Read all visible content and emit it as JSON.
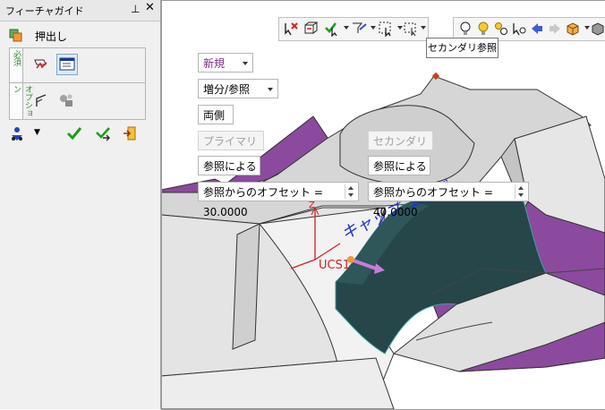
{
  "panel": {
    "title": "フィーチャガイド",
    "pin_icon": "pin-icon",
    "close_icon": "close-icon",
    "command_name": "押出し",
    "required_tab": "必須",
    "optional_tab": "オプション"
  },
  "viewport": {
    "tooltip": "セカンダリ参照",
    "mode_dropdown": "新規",
    "boolean_dropdown": "増分/参照",
    "direction_button": "両側",
    "primary_label": "プライマリ側",
    "secondary_label": "セカンダリ側",
    "primary_ref": "参照による",
    "secondary_ref": "参照による",
    "primary_offset": "参照からのオフセット = 30.0000",
    "secondary_offset": "参照からのオフセット = 40.0000",
    "annotation": "キャップ エンド",
    "csys_label": "UCS1",
    "axis_label": "Z"
  },
  "colors": {
    "accent_purple": "#8b4a9e",
    "face_gray": "#d9d9d9",
    "dark_face": "#26464a",
    "annotation_blue": "#1f2fd8",
    "check_green": "#1aa01a"
  }
}
